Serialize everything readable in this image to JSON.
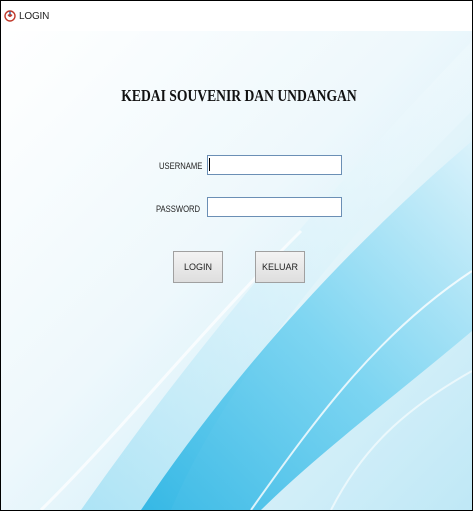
{
  "window": {
    "title": "LOGIN",
    "icon": "java-coffee-icon"
  },
  "form": {
    "heading": "KEDAI SOUVENIR DAN UNDANGAN",
    "username_label": "USERNAME",
    "username_value": "",
    "password_label": "PASSWORD",
    "password_value": "",
    "login_label": "LOGIN",
    "exit_label": "KELUAR"
  },
  "colors": {
    "background_light": "#eaf6fb",
    "background_accent": "#4fc3e8",
    "field_border": "#6b8fb5",
    "button_border": "#a0a0a0"
  }
}
